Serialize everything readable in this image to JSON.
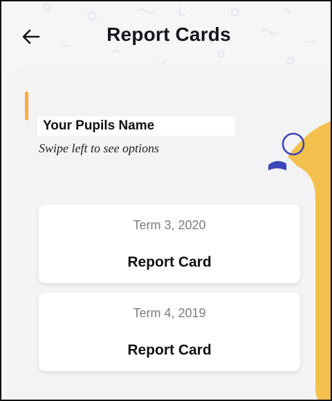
{
  "header": {
    "title": "Report Cards",
    "back_icon": "arrow-left-icon"
  },
  "pupil": {
    "name": "Your Pupils Name",
    "hint": "Swipe left to see options"
  },
  "report_cards": [
    {
      "term": "Term 3, 2020",
      "label": "Report Card"
    },
    {
      "term": "Term 4, 2019",
      "label": "Report Card"
    }
  ],
  "colors": {
    "accent": "#f2b13e",
    "decor_circle": "#3b46b8",
    "background": "#f6f6f8",
    "card": "#ffffff"
  }
}
